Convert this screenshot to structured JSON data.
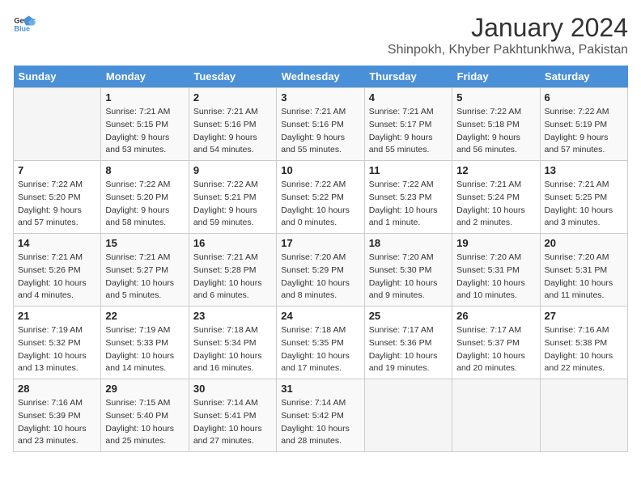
{
  "logo": {
    "text_general": "General",
    "text_blue": "Blue"
  },
  "title": "January 2024",
  "subtitle": "Shinpokh, Khyber Pakhtunkhwa, Pakistan",
  "days_of_week": [
    "Sunday",
    "Monday",
    "Tuesday",
    "Wednesday",
    "Thursday",
    "Friday",
    "Saturday"
  ],
  "weeks": [
    [
      {
        "day": "",
        "info": ""
      },
      {
        "day": "1",
        "info": "Sunrise: 7:21 AM\nSunset: 5:15 PM\nDaylight: 9 hours\nand 53 minutes."
      },
      {
        "day": "2",
        "info": "Sunrise: 7:21 AM\nSunset: 5:16 PM\nDaylight: 9 hours\nand 54 minutes."
      },
      {
        "day": "3",
        "info": "Sunrise: 7:21 AM\nSunset: 5:16 PM\nDaylight: 9 hours\nand 55 minutes."
      },
      {
        "day": "4",
        "info": "Sunrise: 7:21 AM\nSunset: 5:17 PM\nDaylight: 9 hours\nand 55 minutes."
      },
      {
        "day": "5",
        "info": "Sunrise: 7:22 AM\nSunset: 5:18 PM\nDaylight: 9 hours\nand 56 minutes."
      },
      {
        "day": "6",
        "info": "Sunrise: 7:22 AM\nSunset: 5:19 PM\nDaylight: 9 hours\nand 57 minutes."
      }
    ],
    [
      {
        "day": "7",
        "info": "Sunrise: 7:22 AM\nSunset: 5:20 PM\nDaylight: 9 hours\nand 57 minutes."
      },
      {
        "day": "8",
        "info": "Sunrise: 7:22 AM\nSunset: 5:20 PM\nDaylight: 9 hours\nand 58 minutes."
      },
      {
        "day": "9",
        "info": "Sunrise: 7:22 AM\nSunset: 5:21 PM\nDaylight: 9 hours\nand 59 minutes."
      },
      {
        "day": "10",
        "info": "Sunrise: 7:22 AM\nSunset: 5:22 PM\nDaylight: 10 hours\nand 0 minutes."
      },
      {
        "day": "11",
        "info": "Sunrise: 7:22 AM\nSunset: 5:23 PM\nDaylight: 10 hours\nand 1 minute."
      },
      {
        "day": "12",
        "info": "Sunrise: 7:21 AM\nSunset: 5:24 PM\nDaylight: 10 hours\nand 2 minutes."
      },
      {
        "day": "13",
        "info": "Sunrise: 7:21 AM\nSunset: 5:25 PM\nDaylight: 10 hours\nand 3 minutes."
      }
    ],
    [
      {
        "day": "14",
        "info": "Sunrise: 7:21 AM\nSunset: 5:26 PM\nDaylight: 10 hours\nand 4 minutes."
      },
      {
        "day": "15",
        "info": "Sunrise: 7:21 AM\nSunset: 5:27 PM\nDaylight: 10 hours\nand 5 minutes."
      },
      {
        "day": "16",
        "info": "Sunrise: 7:21 AM\nSunset: 5:28 PM\nDaylight: 10 hours\nand 6 minutes."
      },
      {
        "day": "17",
        "info": "Sunrise: 7:20 AM\nSunset: 5:29 PM\nDaylight: 10 hours\nand 8 minutes."
      },
      {
        "day": "18",
        "info": "Sunrise: 7:20 AM\nSunset: 5:30 PM\nDaylight: 10 hours\nand 9 minutes."
      },
      {
        "day": "19",
        "info": "Sunrise: 7:20 AM\nSunset: 5:31 PM\nDaylight: 10 hours\nand 10 minutes."
      },
      {
        "day": "20",
        "info": "Sunrise: 7:20 AM\nSunset: 5:31 PM\nDaylight: 10 hours\nand 11 minutes."
      }
    ],
    [
      {
        "day": "21",
        "info": "Sunrise: 7:19 AM\nSunset: 5:32 PM\nDaylight: 10 hours\nand 13 minutes."
      },
      {
        "day": "22",
        "info": "Sunrise: 7:19 AM\nSunset: 5:33 PM\nDaylight: 10 hours\nand 14 minutes."
      },
      {
        "day": "23",
        "info": "Sunrise: 7:18 AM\nSunset: 5:34 PM\nDaylight: 10 hours\nand 16 minutes."
      },
      {
        "day": "24",
        "info": "Sunrise: 7:18 AM\nSunset: 5:35 PM\nDaylight: 10 hours\nand 17 minutes."
      },
      {
        "day": "25",
        "info": "Sunrise: 7:17 AM\nSunset: 5:36 PM\nDaylight: 10 hours\nand 19 minutes."
      },
      {
        "day": "26",
        "info": "Sunrise: 7:17 AM\nSunset: 5:37 PM\nDaylight: 10 hours\nand 20 minutes."
      },
      {
        "day": "27",
        "info": "Sunrise: 7:16 AM\nSunset: 5:38 PM\nDaylight: 10 hours\nand 22 minutes."
      }
    ],
    [
      {
        "day": "28",
        "info": "Sunrise: 7:16 AM\nSunset: 5:39 PM\nDaylight: 10 hours\nand 23 minutes."
      },
      {
        "day": "29",
        "info": "Sunrise: 7:15 AM\nSunset: 5:40 PM\nDaylight: 10 hours\nand 25 minutes."
      },
      {
        "day": "30",
        "info": "Sunrise: 7:14 AM\nSunset: 5:41 PM\nDaylight: 10 hours\nand 27 minutes."
      },
      {
        "day": "31",
        "info": "Sunrise: 7:14 AM\nSunset: 5:42 PM\nDaylight: 10 hours\nand 28 minutes."
      },
      {
        "day": "",
        "info": ""
      },
      {
        "day": "",
        "info": ""
      },
      {
        "day": "",
        "info": ""
      }
    ]
  ]
}
